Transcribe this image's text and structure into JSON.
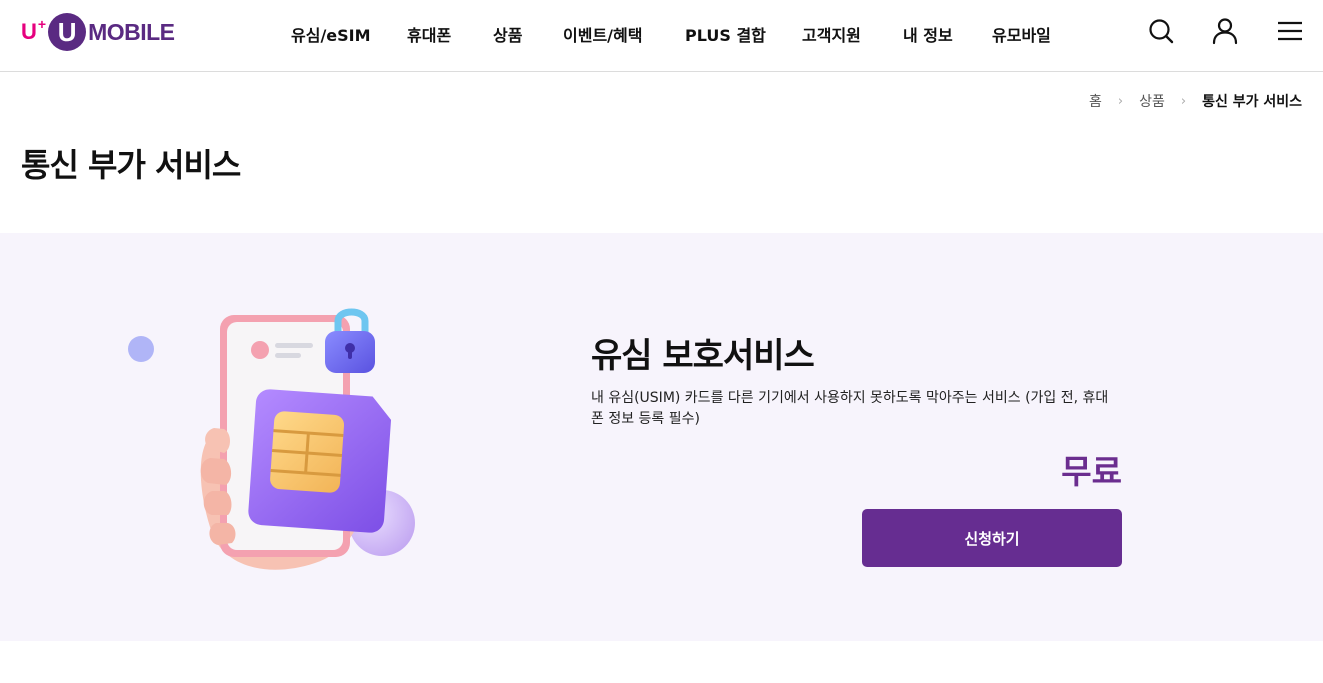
{
  "brand": {
    "logo_prefix": "U",
    "logo_plus": "+",
    "logo_circle": "U",
    "logo_text": "MOBILE",
    "primary_color": "#662d91",
    "accent_color": "#e6007e"
  },
  "nav": {
    "items": [
      {
        "label": "유심/eSIM"
      },
      {
        "label": "휴대폰"
      },
      {
        "label": "상품"
      },
      {
        "label": "이벤트/혜택"
      },
      {
        "label": "PLUS 결합"
      },
      {
        "label": "고객지원"
      },
      {
        "label": "내 정보"
      },
      {
        "label": "유모바일"
      }
    ],
    "icons": [
      "search-icon",
      "user-icon",
      "menu-icon"
    ]
  },
  "breadcrumb": {
    "items": [
      "홈",
      "상품",
      "통신 부가 서비스"
    ],
    "separator": "›"
  },
  "page": {
    "title": "통신 부가 서비스"
  },
  "service": {
    "name": "유심 보호서비스",
    "description": "내 유심(USIM) 카드를 다른 기기에서 사용하지 못하도록 막아주는 서비스 (가입 전, 휴대폰 정보 등록 필수)",
    "price": "무료",
    "apply_label": "신청하기",
    "illustration": "phone-with-sim-and-lock-illustration"
  }
}
